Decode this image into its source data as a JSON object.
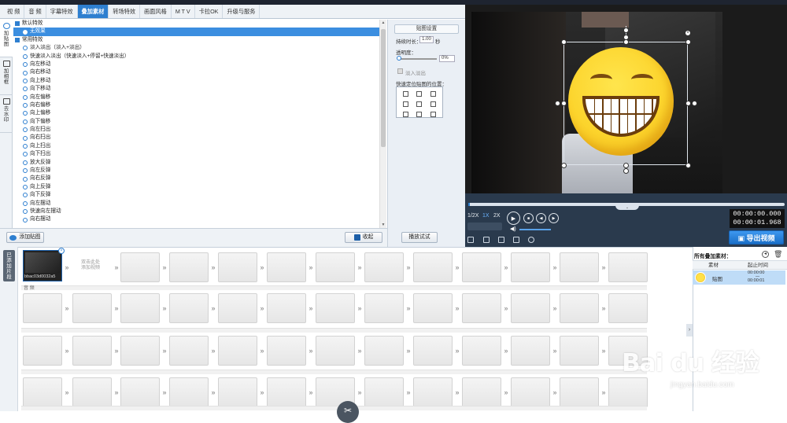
{
  "tabs": [
    "视 频",
    "音 频",
    "字幕特效",
    "叠加素材",
    "转场特效",
    "画面风格",
    "M T V",
    "卡拉OK",
    "升级与服务"
  ],
  "active_tab": "叠加素材",
  "side_tabs": [
    {
      "label": "加\n贴\n图",
      "active": true
    },
    {
      "label": "加\n相\n框",
      "active": false
    },
    {
      "label": "去\n水\n印",
      "active": false
    }
  ],
  "effects": {
    "groups": [
      {
        "title": "默认特效",
        "items": [
          "无效果"
        ],
        "selected": "无效果"
      },
      {
        "title": "常用特效",
        "items": [
          "淡入淡出（淡入+淡出）",
          "快速淡入淡出（快速淡入+停留+快速淡出）",
          "向左移动",
          "向右移动",
          "向上移动",
          "向下移动",
          "向左偏移",
          "向右偏移",
          "向上偏移",
          "向下偏移",
          "向左扫出",
          "向右扫出",
          "向上扫出",
          "向下扫出",
          "放大反弹",
          "向左反弹",
          "向右反弹",
          "向上反弹",
          "向下反弹",
          "向左摆动",
          "快速向左摆动",
          "向右摆动"
        ]
      }
    ]
  },
  "settings": {
    "header": "贴图设置",
    "duration_label": "持续时长：",
    "duration_value": "1.00",
    "duration_unit": "秒",
    "opacity_label": "透明度：",
    "opacity_value": "0%",
    "fade_label": "淡入淡出",
    "position_label": "快速定位贴图的位置：",
    "preview_button": "播放试试"
  },
  "bottom_buttons": {
    "add_sticker": "添加贴图",
    "collapse": "收起"
  },
  "player": {
    "speeds": [
      "1/2X",
      "1X",
      "2X"
    ],
    "active_speed": "1X",
    "time_current": "00:00:00.000",
    "time_total": "00:00:01.968",
    "export_label": "导出视频",
    "progress_fraction": 0.005
  },
  "timeline": {
    "side_label": "已\n添\n加\n片\n段",
    "clip_name": "bbac03d0032a5",
    "add_placeholder": "双击此处\n添加视频",
    "track_label": "音 频"
  },
  "overlay_panel": {
    "title": "所有叠加素材：",
    "col_material": "素材",
    "col_time": "起止时间",
    "row_name": "贴图",
    "row_start": "00:00:00",
    "row_end": "00:00:01",
    "row_dash": "—"
  },
  "watermark": {
    "brand": "Bai du 经验",
    "url": "jingyan.baidu.com"
  },
  "colors": {
    "accent": "#2e7fd0",
    "player_bg": "#2a3a4d",
    "export": "#1a6fc8"
  }
}
